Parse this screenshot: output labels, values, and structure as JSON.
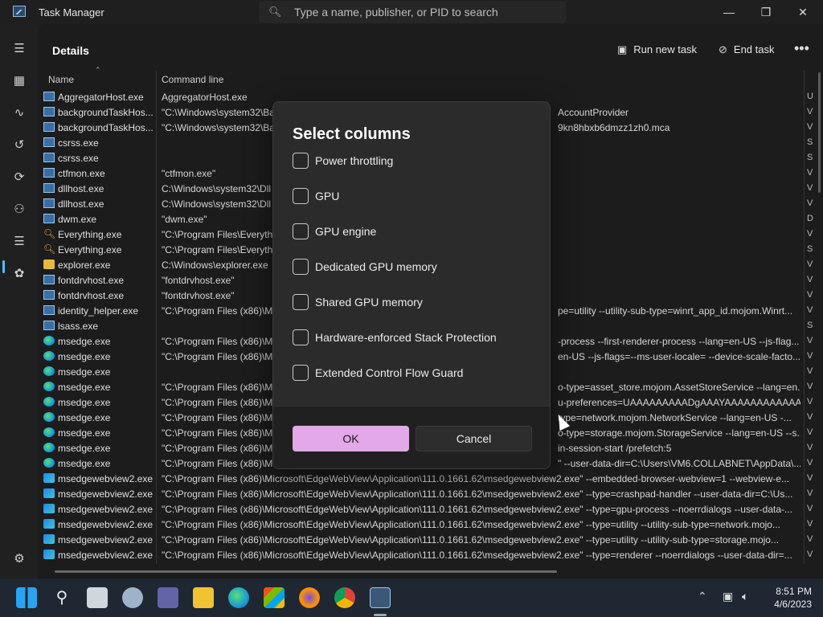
{
  "window": {
    "title": "Task Manager",
    "search_placeholder": "Type a name, publisher, or PID to search",
    "minimize": "—",
    "maximize": "❐",
    "close": "✕"
  },
  "page": {
    "title": "Details",
    "run_new_task": "Run new task",
    "end_task": "End task",
    "more": "•••"
  },
  "columns": {
    "name": "Name",
    "command_line": "Command line"
  },
  "rows": [
    {
      "icon": "app",
      "name": "AggregatorHost.exe",
      "cmd": "AggregatorHost.exe"
    },
    {
      "icon": "app",
      "name": "backgroundTaskHos...",
      "cmd": "\"C:\\Windows\\system32\\Ba",
      "tail": "AccountProvider"
    },
    {
      "icon": "app",
      "name": "backgroundTaskHos...",
      "cmd": "\"C:\\Windows\\system32\\Ba",
      "tail": "9kn8hbxb6dmzz1zh0.mca"
    },
    {
      "icon": "app",
      "name": "csrss.exe",
      "cmd": ""
    },
    {
      "icon": "app",
      "name": "csrss.exe",
      "cmd": ""
    },
    {
      "icon": "app",
      "name": "ctfmon.exe",
      "cmd": "\"ctfmon.exe\""
    },
    {
      "icon": "app",
      "name": "dllhost.exe",
      "cmd": "C:\\Windows\\system32\\Dll"
    },
    {
      "icon": "app",
      "name": "dllhost.exe",
      "cmd": "C:\\Windows\\system32\\Dll"
    },
    {
      "icon": "app",
      "name": "dwm.exe",
      "cmd": "\"dwm.exe\""
    },
    {
      "icon": "search",
      "name": "Everything.exe",
      "cmd": "\"C:\\Program Files\\Everythi"
    },
    {
      "icon": "search",
      "name": "Everything.exe",
      "cmd": "\"C:\\Program Files\\Everythi"
    },
    {
      "icon": "folder",
      "name": "explorer.exe",
      "cmd": "C:\\Windows\\explorer.exe"
    },
    {
      "icon": "app",
      "name": "fontdrvhost.exe",
      "cmd": "\"fontdrvhost.exe\""
    },
    {
      "icon": "app",
      "name": "fontdrvhost.exe",
      "cmd": "\"fontdrvhost.exe\""
    },
    {
      "icon": "app",
      "name": "identity_helper.exe",
      "cmd": "\"C:\\Program Files (x86)\\M",
      "tail": "pe=utility --utility-sub-type=winrt_app_id.mojom.Winrt..."
    },
    {
      "icon": "app",
      "name": "lsass.exe",
      "cmd": ""
    },
    {
      "icon": "edge",
      "name": "msedge.exe",
      "cmd": "\"C:\\Program Files (x86)\\M",
      "tail": "-process --first-renderer-process --lang=en-US --js-flag..."
    },
    {
      "icon": "edge",
      "name": "msedge.exe",
      "cmd": "\"C:\\Program Files (x86)\\M",
      "tail": "en-US --js-flags=--ms-user-locale= --device-scale-facto..."
    },
    {
      "icon": "edge",
      "name": "msedge.exe",
      "cmd": ""
    },
    {
      "icon": "edge",
      "name": "msedge.exe",
      "cmd": "\"C:\\Program Files (x86)\\M",
      "tail": "o-type=asset_store.mojom.AssetStoreService --lang=en..."
    },
    {
      "icon": "edge",
      "name": "msedge.exe",
      "cmd": "\"C:\\Program Files (x86)\\M",
      "tail": "u-preferences=UAAAAAAAAADgAAAYAAAAAAAAAAAA..."
    },
    {
      "icon": "edge",
      "name": "msedge.exe",
      "cmd": "\"C:\\Program Files (x86)\\M",
      "tail": "type=network.mojom.NetworkService --lang=en-US -..."
    },
    {
      "icon": "edge",
      "name": "msedge.exe",
      "cmd": "\"C:\\Program Files (x86)\\M",
      "tail": "o-type=storage.mojom.StorageService --lang=en-US --s..."
    },
    {
      "icon": "edge",
      "name": "msedge.exe",
      "cmd": "\"C:\\Program Files (x86)\\M",
      "tail": "in-session-start /prefetch:5"
    },
    {
      "icon": "edge",
      "name": "msedge.exe",
      "cmd": "\"C:\\Program Files (x86)\\M",
      "tail": "\" --user-data-dir=C:\\Users\\VM6.COLLABNET\\AppData\\..."
    },
    {
      "icon": "web",
      "name": "msedgewebview2.exe",
      "cmd": "\"C:\\Program Files (x86)\\Microsoft\\EdgeWebView\\Application\\111.0.1661.62\\msedgewebview2.exe\" --embedded-browser-webview=1 --webview-e..."
    },
    {
      "icon": "web",
      "name": "msedgewebview2.exe",
      "cmd": "\"C:\\Program Files (x86)\\Microsoft\\EdgeWebView\\Application\\111.0.1661.62\\msedgewebview2.exe\" --type=crashpad-handler --user-data-dir=C:\\Us..."
    },
    {
      "icon": "web",
      "name": "msedgewebview2.exe",
      "cmd": "\"C:\\Program Files (x86)\\Microsoft\\EdgeWebView\\Application\\111.0.1661.62\\msedgewebview2.exe\" --type=gpu-process --noerrdialogs --user-data-..."
    },
    {
      "icon": "web",
      "name": "msedgewebview2.exe",
      "cmd": "\"C:\\Program Files (x86)\\Microsoft\\EdgeWebView\\Application\\111.0.1661.62\\msedgewebview2.exe\" --type=utility --utility-sub-type=network.mojo..."
    },
    {
      "icon": "web",
      "name": "msedgewebview2.exe",
      "cmd": "\"C:\\Program Files (x86)\\Microsoft\\EdgeWebView\\Application\\111.0.1661.62\\msedgewebview2.exe\" --type=utility --utility-sub-type=storage.mojo..."
    },
    {
      "icon": "web",
      "name": "msedgewebview2.exe",
      "cmd": "\"C:\\Program Files (x86)\\Microsoft\\EdgeWebView\\Application\\111.0.1661.62\\msedgewebview2.exe\" --type=renderer --noerrdialogs --user-data-dir=..."
    }
  ],
  "right_column_letters": [
    "U",
    "V",
    "V",
    "S",
    "S",
    "V",
    "V",
    "V",
    "D",
    "V",
    "S",
    "V",
    "V",
    "V",
    "V",
    "S",
    "V",
    "V",
    "V",
    "V",
    "V",
    "V",
    "V",
    "V",
    "V",
    "V",
    "V",
    "V",
    "V",
    "V",
    "V"
  ],
  "dialog": {
    "title": "Select columns",
    "options": [
      {
        "label": "Power throttling",
        "checked": false
      },
      {
        "label": "GPU",
        "checked": false
      },
      {
        "label": "GPU engine",
        "checked": false
      },
      {
        "label": "Dedicated GPU memory",
        "checked": false
      },
      {
        "label": "Shared GPU memory",
        "checked": false
      },
      {
        "label": "Hardware-enforced Stack Protection",
        "checked": false
      },
      {
        "label": "Extended Control Flow Guard",
        "checked": false
      }
    ],
    "ok": "OK",
    "cancel": "Cancel"
  },
  "taskbar": {
    "time": "8:51 PM",
    "date": "4/6/2023"
  },
  "colors": {
    "accent_ok": "#e3a8e8",
    "nav_indicator": "#4cc2ff"
  }
}
